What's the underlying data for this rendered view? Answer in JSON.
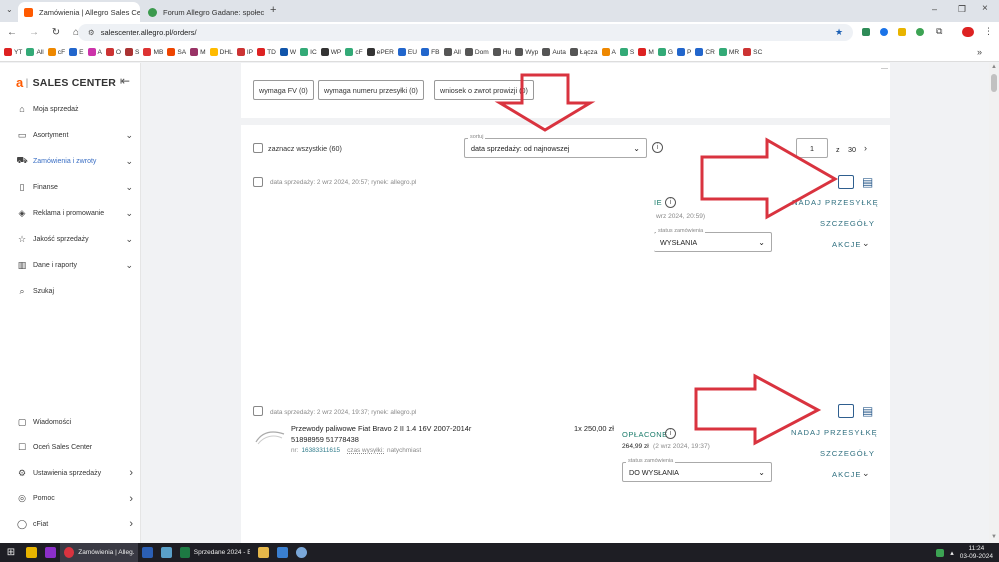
{
  "browser": {
    "tabs": [
      {
        "title": "Zamówienia | Allegro Sales Cen",
        "active": true,
        "color": "#ff5a00"
      },
      {
        "title": "Forum Allegro Gadane: społec",
        "active": false,
        "color": "#3c9a4e"
      }
    ],
    "new_tab_label": "+",
    "url": "salescenter.allegro.pl/orders/",
    "bookmarks": [
      "YT",
      "All",
      "cF",
      "E",
      "A",
      "O",
      "S",
      "MB",
      "SA",
      "M",
      "DHL",
      "IP",
      "TD",
      "W",
      "IC",
      "WP",
      "cF",
      "ePER",
      "EU",
      "FB",
      "All",
      "Dom",
      "Hu",
      "Wyp",
      "Auta",
      "Łącza",
      "A",
      "S",
      "M",
      "G",
      "P",
      "CR",
      "MR",
      "SC"
    ]
  },
  "sidebar": {
    "logo_mark": "a",
    "logo_text": "SALES CENTER",
    "collapse_icon": "collapse-arrow-icon",
    "items": [
      {
        "label": "Moja sprzedaż",
        "icon": "home-icon",
        "chevron": false
      },
      {
        "label": "Asortyment",
        "icon": "box-icon",
        "chevron": true
      },
      {
        "label": "Zamówienia i zwroty",
        "icon": "cart-icon",
        "chevron": true,
        "active": true
      },
      {
        "label": "Finanse",
        "icon": "wallet-icon",
        "chevron": true
      },
      {
        "label": "Reklama i promowanie",
        "icon": "tag-icon",
        "chevron": true
      },
      {
        "label": "Jakość sprzedaży",
        "icon": "star-icon",
        "chevron": true
      },
      {
        "label": "Dane i raporty",
        "icon": "chart-icon",
        "chevron": true
      },
      {
        "label": "Szukaj",
        "icon": "search-icon",
        "chevron": false
      }
    ],
    "bottom_items": [
      {
        "label": "Wiadomości",
        "icon": "message-icon",
        "chevron": false
      },
      {
        "label": "Oceń Sales Center",
        "icon": "feedback-icon",
        "chevron": false
      },
      {
        "label": "Ustawienia sprzedaży",
        "icon": "gear-icon",
        "chevron": true
      },
      {
        "label": "Pomoc",
        "icon": "help-icon",
        "chevron": true
      },
      {
        "label": "cFiat",
        "icon": "user-icon",
        "chevron": true
      }
    ]
  },
  "filters": {
    "buttons": [
      "wymaga FV (0)",
      "wymaga numeru przesyłki (0)",
      "wniosek o zwrot prowizji (0)"
    ]
  },
  "list_header": {
    "select_all": "zaznacz wszystkie (60)",
    "sort_legend": "sortuj",
    "sort_value": "data sprzedaży: od najnowszej",
    "page_current": "1",
    "page_of": "z",
    "page_total": "30"
  },
  "orders": [
    {
      "meta": "data sprzedaży: 2 wrz 2024, 20:57; rynek: allegro.pl",
      "status": "",
      "status_partial": "IE",
      "paid_partial": "wrz 2024, 20:59)",
      "status_legend": "status zamówienia",
      "status_value": "WYSŁANIA",
      "send": "NADAJ PRZESYŁKĘ",
      "details": "SZCZEGÓŁY",
      "actions": "AKCJE"
    },
    {
      "meta": "data sprzedaży: 2 wrz 2024, 19:37; rynek: allegro.pl",
      "title_line1": "Przewody paliwowe Fiat Bravo 2 II 1.4 16V 2007-2014r",
      "title_line2": "51898959 51778438",
      "qty_price": "1x 250,00 zł",
      "offer_no_prefix": "nr:",
      "offer_no": "16383311615",
      "shipping_label": "czas wysyłki:",
      "shipping_value": "natychmiast",
      "status": "OPŁACONE",
      "paid_amount": "264,99 zł",
      "paid_date": "(2 wrz 2024, 19:37)",
      "status_legend": "status zamówienia",
      "status_value": "DO WYSŁANIA",
      "send": "NADAJ PRZESYŁKĘ",
      "details": "SZCZEGÓŁY",
      "actions": "AKCJE"
    }
  ],
  "taskbar": {
    "items": [
      "Zamówienia | Alleg...",
      "Sprzedane 2024 - E..."
    ],
    "time": "11:24",
    "date": "03-09-2024"
  },
  "colors": {
    "brand": "#ff5a00",
    "arrow": "#d9333f",
    "link": "#2f6f7f"
  }
}
